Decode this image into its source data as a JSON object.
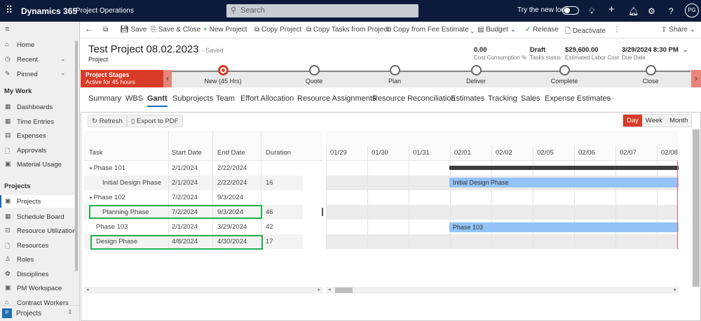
{
  "app": {
    "brand": "Dynamics 365",
    "app_name": "Project Operations",
    "search_placeholder": "Search",
    "try_new_look": "Try the new look",
    "avatar": "PG"
  },
  "commands": {
    "save": "Save",
    "save_close": "Save & Close",
    "new_project": "New Project",
    "copy_project": "Copy Project",
    "copy_tasks": "Copy Tasks from Project",
    "copy_fee": "Copy from Fee Estimate",
    "budget": "Budget",
    "release": "Release",
    "deactivate": "Deactivate",
    "share": "Share"
  },
  "sidebar": {
    "top": [
      {
        "label": "Home"
      },
      {
        "label": "Recent"
      },
      {
        "label": "Pinned"
      }
    ],
    "my_work_title": "My Work",
    "my_work": [
      {
        "label": "Dashboards"
      },
      {
        "label": "Time Entries"
      },
      {
        "label": "Expenses"
      },
      {
        "label": "Approvals"
      },
      {
        "label": "Material Usage"
      }
    ],
    "projects_title": "Projects",
    "projects": [
      {
        "label": "Projects"
      },
      {
        "label": "Schedule Board"
      },
      {
        "label": "Resource Utilization"
      },
      {
        "label": "Resources"
      },
      {
        "label": "Roles"
      },
      {
        "label": "Disciplines"
      },
      {
        "label": "PM Workspace"
      },
      {
        "label": "Contract Workers"
      }
    ],
    "area": {
      "badge": "P",
      "label": "Projects"
    }
  },
  "record": {
    "title": "Test Project 08.02.2023",
    "saved": "- Saved",
    "entity": "Project",
    "fields": [
      {
        "value": "0.00",
        "label": "Cost Consumption %"
      },
      {
        "value": "Draft",
        "label": "Tasks status"
      },
      {
        "value": "$29,600.00",
        "label": "Estimated Labor Cost"
      },
      {
        "value": "3/29/2024 8:30 PM",
        "label": "Due Date"
      }
    ]
  },
  "stages": {
    "title": "Project Stages",
    "subtitle": "Active for 45 hours",
    "items": [
      "New  (45 Hrs)",
      "Quote",
      "Plan",
      "Deliver",
      "Complete",
      "Close"
    ],
    "active_color": "#d83b27"
  },
  "tabs": [
    "Summary",
    "WBS",
    "Gantt",
    "Subprojects",
    "Team",
    "Effort Allocation",
    "Resource Assignments",
    "Resource Reconciliation",
    "Estimates",
    "Tracking",
    "Sales",
    "Expense Estimates",
    "···"
  ],
  "active_tab": "Gantt",
  "gantt": {
    "refresh": "Refresh",
    "export": "Export to PDF",
    "views": [
      "Day",
      "Week",
      "Month"
    ],
    "active_view": "Day",
    "columns": [
      "Task",
      "Start Date",
      "End Date",
      "Duration"
    ],
    "rows": [
      {
        "task": "Phase 101",
        "start": "2/1/2024",
        "end": "2/22/2024",
        "duration": "",
        "parent": true
      },
      {
        "task": "Initial Design Phase",
        "start": "2/1/2024",
        "end": "2/22/2024",
        "duration": "16",
        "child": true
      },
      {
        "task": "Phase 102",
        "start": "7/2/2024",
        "end": "9/3/2024",
        "duration": "",
        "parent": true
      },
      {
        "task": "Planning Phase",
        "start": "7/2/2024",
        "end": "9/3/2024",
        "duration": "46",
        "child": true,
        "highlighted": true
      },
      {
        "task": "Phase 103",
        "start": "2/1/2024",
        "end": "3/29/2024",
        "duration": "42"
      },
      {
        "task": "Design Phase",
        "start": "4/8/2024",
        "end": "4/30/2024",
        "duration": "17",
        "highlighted": true
      }
    ],
    "dates": [
      "01/29",
      "01/30",
      "01/31",
      "02/01",
      "02/02",
      "02/05",
      "02/06",
      "02/07",
      "02/08"
    ],
    "bars": {
      "initial": "Initial Design Phase",
      "phase103": "Phase 103"
    },
    "bar_color": "#93c3f7",
    "highlight_color": "#22b14c"
  }
}
